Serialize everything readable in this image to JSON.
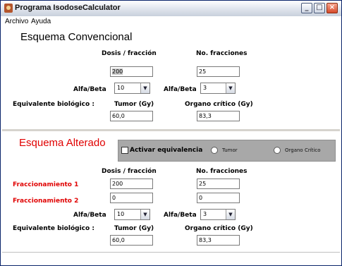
{
  "window": {
    "title": "Programa IsodoseCalculator"
  },
  "menu": {
    "items": [
      "Archivo",
      "Ayuda"
    ]
  },
  "conventional": {
    "title": "Esquema Convencional",
    "dose_label": "Dosis / fracción",
    "fractions_label": "No. fracciones",
    "dose_value": "200",
    "fractions_value": "25",
    "alfa_beta_label_1": "Alfa/Beta",
    "alfa_beta_value_1": "10",
    "alfa_beta_label_2": "Alfa/Beta",
    "alfa_beta_value_2": "3",
    "equiv_label": "Equivalente biológico :",
    "tumor_label": "Tumor (Gy)",
    "organ_label": "Organo  crítico (Gy)",
    "tumor_value": "60,0",
    "organ_value": "83,3"
  },
  "altered": {
    "title": "Esquema Alterado",
    "activate_label": "Activar equivalencia",
    "radio_tumor": "Tumor",
    "radio_organ": "Organo Crítico",
    "dose_label": "Dosis / fracción",
    "fractions_label": "No. fracciones",
    "frac1_label": "Fraccionamiento 1",
    "frac2_label": "Fraccionamiento 2",
    "frac1_dose": "200",
    "frac1_fractions": "25",
    "frac2_dose": "0",
    "frac2_fractions": "0",
    "alfa_beta_label_1": "Alfa/Beta",
    "alfa_beta_value_1": "10",
    "alfa_beta_label_2": "Alfa/Beta",
    "alfa_beta_value_2": "3",
    "equiv_label": "Equivalente biológico :",
    "tumor_label": "Tumor (Gy)",
    "organ_label": "Organo  crítico (Gy)",
    "tumor_value": "60,0",
    "organ_value": "83,3"
  },
  "colors": {
    "title_red": "#e00000",
    "label_red": "#e00000"
  }
}
